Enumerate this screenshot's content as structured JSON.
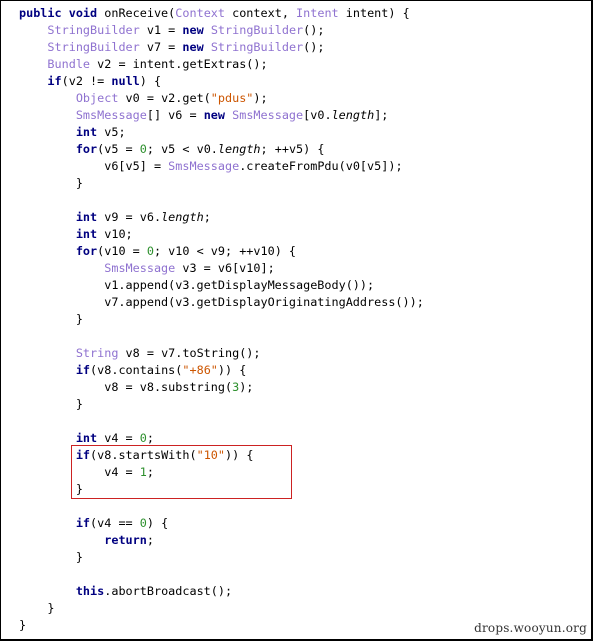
{
  "colors": {
    "keyword": "#000080",
    "type": "#8f72d0",
    "string": "#cc5500",
    "number": "#2c8f2c",
    "highlight_border": "#cc2222"
  },
  "code_lines": [
    [
      [
        "keyword",
        "public void"
      ],
      [
        "plain",
        " onReceive("
      ],
      [
        "type",
        "Context"
      ],
      [
        "plain",
        " context, "
      ],
      [
        "type",
        "Intent"
      ],
      [
        "plain",
        " intent) {"
      ]
    ],
    [
      [
        "plain",
        "    "
      ],
      [
        "type",
        "StringBuilder"
      ],
      [
        "plain",
        " v1 = "
      ],
      [
        "keyword",
        "new"
      ],
      [
        "plain",
        " "
      ],
      [
        "type",
        "StringBuilder"
      ],
      [
        "plain",
        "();"
      ]
    ],
    [
      [
        "plain",
        "    "
      ],
      [
        "type",
        "StringBuilder"
      ],
      [
        "plain",
        " v7 = "
      ],
      [
        "keyword",
        "new"
      ],
      [
        "plain",
        " "
      ],
      [
        "type",
        "StringBuilder"
      ],
      [
        "plain",
        "();"
      ]
    ],
    [
      [
        "plain",
        "    "
      ],
      [
        "type",
        "Bundle"
      ],
      [
        "plain",
        " v2 = intent.getExtras();"
      ]
    ],
    [
      [
        "plain",
        "    "
      ],
      [
        "keyword",
        "if"
      ],
      [
        "plain",
        "(v2 != "
      ],
      [
        "keyword",
        "null"
      ],
      [
        "plain",
        ") {"
      ]
    ],
    [
      [
        "plain",
        "        "
      ],
      [
        "type",
        "Object"
      ],
      [
        "plain",
        " v0 = v2.get("
      ],
      [
        "string",
        "\"pdus\""
      ],
      [
        "plain",
        ");"
      ]
    ],
    [
      [
        "plain",
        "        "
      ],
      [
        "type",
        "SmsMessage"
      ],
      [
        "plain",
        "[] v6 = "
      ],
      [
        "keyword",
        "new"
      ],
      [
        "plain",
        " "
      ],
      [
        "type",
        "SmsMessage"
      ],
      [
        "plain",
        "[v0."
      ],
      [
        "field",
        "length"
      ],
      [
        "plain",
        "];"
      ]
    ],
    [
      [
        "plain",
        "        "
      ],
      [
        "keyword",
        "int"
      ],
      [
        "plain",
        " v5;"
      ]
    ],
    [
      [
        "plain",
        "        "
      ],
      [
        "keyword",
        "for"
      ],
      [
        "plain",
        "(v5 = "
      ],
      [
        "number",
        "0"
      ],
      [
        "plain",
        "; v5 < v0."
      ],
      [
        "field",
        "length"
      ],
      [
        "plain",
        "; ++v5) {"
      ]
    ],
    [
      [
        "plain",
        "            v6[v5] = "
      ],
      [
        "type",
        "SmsMessage"
      ],
      [
        "plain",
        ".createFromPdu(v0[v5]);"
      ]
    ],
    [
      [
        "plain",
        "        }"
      ]
    ],
    [],
    [
      [
        "plain",
        "        "
      ],
      [
        "keyword",
        "int"
      ],
      [
        "plain",
        " v9 = v6."
      ],
      [
        "field",
        "length"
      ],
      [
        "plain",
        ";"
      ]
    ],
    [
      [
        "plain",
        "        "
      ],
      [
        "keyword",
        "int"
      ],
      [
        "plain",
        " v10;"
      ]
    ],
    [
      [
        "plain",
        "        "
      ],
      [
        "keyword",
        "for"
      ],
      [
        "plain",
        "(v10 = "
      ],
      [
        "number",
        "0"
      ],
      [
        "plain",
        "; v10 < v9; ++v10) {"
      ]
    ],
    [
      [
        "plain",
        "            "
      ],
      [
        "type",
        "SmsMessage"
      ],
      [
        "plain",
        " v3 = v6[v10];"
      ]
    ],
    [
      [
        "plain",
        "            v1.append(v3.getDisplayMessageBody());"
      ]
    ],
    [
      [
        "plain",
        "            v7.append(v3.getDisplayOriginatingAddress());"
      ]
    ],
    [
      [
        "plain",
        "        }"
      ]
    ],
    [],
    [
      [
        "plain",
        "        "
      ],
      [
        "type",
        "String"
      ],
      [
        "plain",
        " v8 = v7.toString();"
      ]
    ],
    [
      [
        "plain",
        "        "
      ],
      [
        "keyword",
        "if"
      ],
      [
        "plain",
        "(v8.contains("
      ],
      [
        "string",
        "\"+86\""
      ],
      [
        "plain",
        ")) {"
      ]
    ],
    [
      [
        "plain",
        "            v8 = v8.substring("
      ],
      [
        "number",
        "3"
      ],
      [
        "plain",
        ");"
      ]
    ],
    [
      [
        "plain",
        "        }"
      ]
    ],
    [],
    [
      [
        "plain",
        "        "
      ],
      [
        "keyword",
        "int"
      ],
      [
        "plain",
        " v4 = "
      ],
      [
        "number",
        "0"
      ],
      [
        "plain",
        ";"
      ]
    ],
    [
      [
        "plain",
        "        "
      ],
      [
        "keyword",
        "if"
      ],
      [
        "plain",
        "(v8.startsWith("
      ],
      [
        "string",
        "\"10\""
      ],
      [
        "plain",
        ")) {"
      ]
    ],
    [
      [
        "plain",
        "            v4 = "
      ],
      [
        "number",
        "1"
      ],
      [
        "plain",
        ";"
      ]
    ],
    [
      [
        "plain",
        "        }"
      ]
    ],
    [],
    [
      [
        "plain",
        "        "
      ],
      [
        "keyword",
        "if"
      ],
      [
        "plain",
        "(v4 == "
      ],
      [
        "number",
        "0"
      ],
      [
        "plain",
        ") {"
      ]
    ],
    [
      [
        "plain",
        "            "
      ],
      [
        "keyword",
        "return"
      ],
      [
        "plain",
        ";"
      ]
    ],
    [
      [
        "plain",
        "        }"
      ]
    ],
    [],
    [
      [
        "plain",
        "        "
      ],
      [
        "keyword",
        "this"
      ],
      [
        "plain",
        ".abortBroadcast();"
      ]
    ],
    [
      [
        "plain",
        "    }"
      ]
    ],
    [
      [
        "plain",
        "}"
      ]
    ]
  ],
  "watermark": "drops.wooyun.org"
}
